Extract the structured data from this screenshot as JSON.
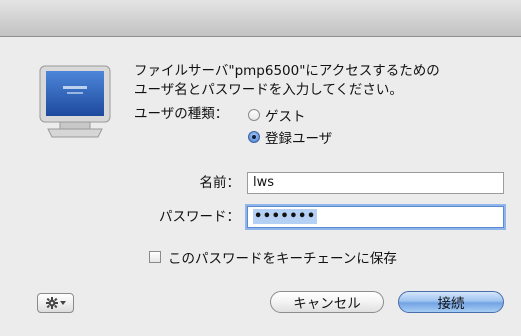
{
  "dialog": {
    "message": "ファイルサーバ\"pmp6500\"にアクセスするための\nユーザ名とパスワードを入力してください。",
    "user_type_label": "ユーザの種類：",
    "user_type_options": [
      {
        "label": "ゲスト",
        "selected": false
      },
      {
        "label": "登録ユーザ",
        "selected": true
      }
    ],
    "name_label": "名前：",
    "name_value": "lws",
    "password_label": "パスワード：",
    "password_value": "•••••••",
    "save_password_label": "このパスワードをキーチェーンに保存",
    "save_password_checked": false,
    "gear_menu_icon": "gear-icon",
    "cancel_label": "キャンセル",
    "connect_label": "接続",
    "colors": {
      "default_button": "#8db8ee",
      "focus_ring": "#8fb5ea"
    }
  }
}
